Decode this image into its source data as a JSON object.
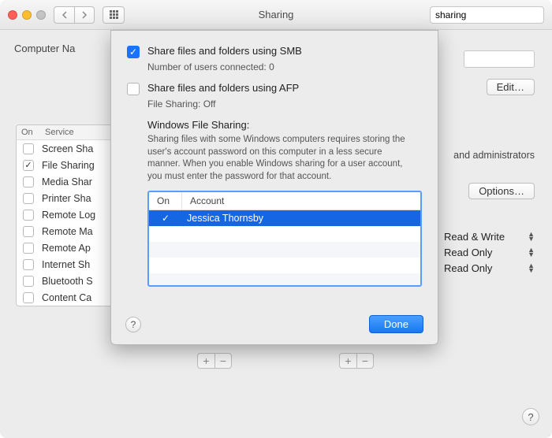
{
  "titlebar": {
    "title": "Sharing",
    "search_value": "sharing"
  },
  "body": {
    "computer_name_label": "Computer Na",
    "edit_label": "Edit…",
    "options_label": "Options…",
    "admin_hint": "and administrators"
  },
  "services": {
    "head_on": "On",
    "head_service": "Service",
    "rows": [
      {
        "on": false,
        "name": "Screen Sha"
      },
      {
        "on": true,
        "name": "File Sharing"
      },
      {
        "on": false,
        "name": "Media Shar"
      },
      {
        "on": false,
        "name": "Printer Sha"
      },
      {
        "on": false,
        "name": "Remote Log"
      },
      {
        "on": false,
        "name": "Remote Ma"
      },
      {
        "on": false,
        "name": "Remote Ap"
      },
      {
        "on": false,
        "name": "Internet Sh"
      },
      {
        "on": false,
        "name": "Bluetooth S"
      },
      {
        "on": false,
        "name": "Content Ca"
      }
    ]
  },
  "permissions": {
    "rows": [
      {
        "label": "Read & Write"
      },
      {
        "label": "Read Only"
      },
      {
        "label": "Read Only"
      }
    ]
  },
  "sheet": {
    "smb_label": "Share files and folders using SMB",
    "smb_sub": "Number of users connected: 0",
    "afp_label": "Share files and folders using AFP",
    "afp_sub": "File Sharing: Off",
    "wfs_title": "Windows File Sharing:",
    "wfs_body": "Sharing files with some Windows computers requires storing the user's account password on this computer in a less secure manner. When you enable Windows sharing for a user account, you must enter the password for that account.",
    "table": {
      "head_on": "On",
      "head_account": "Account",
      "rows": [
        {
          "on": true,
          "account": "Jessica Thornsby",
          "selected": true
        }
      ]
    },
    "done_label": "Done"
  }
}
